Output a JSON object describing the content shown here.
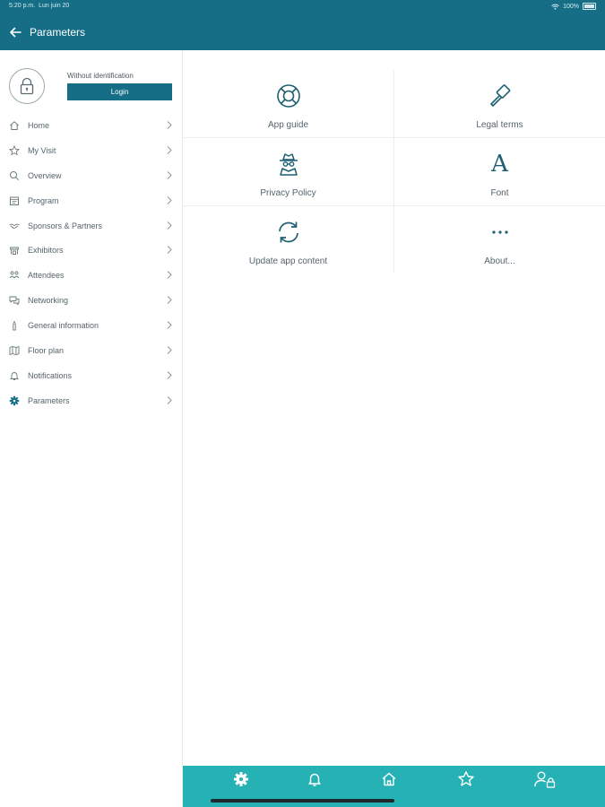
{
  "status": {
    "time": "5:20 p.m.",
    "date": "Lun juin 20",
    "battery": "100%"
  },
  "header": {
    "title": "Parameters"
  },
  "profile": {
    "status_label": "Without identification",
    "login_label": "Login"
  },
  "menu": [
    {
      "label": "Home",
      "icon": "home-icon"
    },
    {
      "label": "My Visit",
      "icon": "star-icon"
    },
    {
      "label": "Overview",
      "icon": "search-icon"
    },
    {
      "label": "Program",
      "icon": "calendar-icon"
    },
    {
      "label": "Sponsors & Partners",
      "icon": "handshake-icon"
    },
    {
      "label": "Exhibitors",
      "icon": "booth-icon"
    },
    {
      "label": "Attendees",
      "icon": "people-icon"
    },
    {
      "label": "Networking",
      "icon": "chat-icon"
    },
    {
      "label": "General information",
      "icon": "info-icon"
    },
    {
      "label": "Floor plan",
      "icon": "map-icon"
    },
    {
      "label": "Notifications",
      "icon": "bell-icon"
    },
    {
      "label": "Parameters",
      "icon": "gear-icon"
    }
  ],
  "settings": [
    {
      "label": "App guide",
      "icon": "lifebuoy-icon"
    },
    {
      "label": "Legal terms",
      "icon": "gavel-icon"
    },
    {
      "label": "Privacy Policy",
      "icon": "spy-icon"
    },
    {
      "label": "Font",
      "icon": "font-icon",
      "glyph": "A"
    },
    {
      "label": "Update app content",
      "icon": "refresh-icon"
    },
    {
      "label": "About...",
      "icon": "more-icon",
      "glyph": "···"
    }
  ],
  "tabs": [
    {
      "icon": "gear-icon"
    },
    {
      "icon": "bell-icon"
    },
    {
      "icon": "home-icon"
    },
    {
      "icon": "star-icon"
    },
    {
      "icon": "user-lock-icon"
    }
  ],
  "colors": {
    "header": "#156e86",
    "tabbar": "#26b2b5",
    "accent": "#156e86",
    "text": "#55646b"
  }
}
